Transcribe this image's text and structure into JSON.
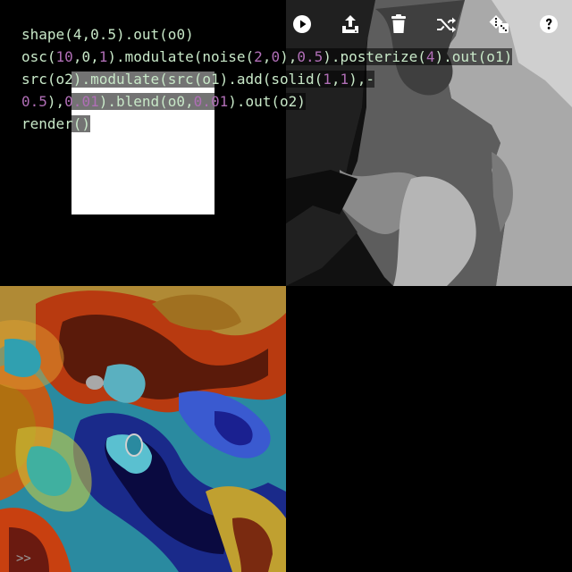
{
  "editor": {
    "lines": [
      [
        {
          "t": "shape",
          "k": "f"
        },
        {
          "t": "(",
          "k": "p"
        },
        {
          "t": "4",
          "k": "f"
        },
        {
          "t": ",",
          "k": "p"
        },
        {
          "t": "0.5",
          "k": "f"
        },
        {
          "t": ").",
          "k": "p"
        },
        {
          "t": "out",
          "k": "f"
        },
        {
          "t": "(o0)",
          "k": "p"
        }
      ],
      [
        {
          "t": "osc",
          "k": "f"
        },
        {
          "t": "(",
          "k": "p"
        },
        {
          "t": "10",
          "k": "n"
        },
        {
          "t": ",",
          "k": "p"
        },
        {
          "t": "0",
          "k": "f"
        },
        {
          "t": ",",
          "k": "p"
        },
        {
          "t": "1",
          "k": "n"
        },
        {
          "t": ").",
          "k": "p"
        },
        {
          "t": "modulate",
          "k": "f"
        },
        {
          "t": "(",
          "k": "p"
        },
        {
          "t": "noise",
          "k": "f"
        },
        {
          "t": "(",
          "k": "p"
        },
        {
          "t": "2",
          "k": "n"
        },
        {
          "t": ",",
          "k": "p"
        },
        {
          "t": "0",
          "k": "n"
        },
        {
          "t": "),",
          "k": "p"
        },
        {
          "t": "0.5",
          "k": "n"
        },
        {
          "t": ").",
          "k": "p"
        },
        {
          "t": "posterize",
          "k": "f"
        },
        {
          "t": "(",
          "k": "p"
        },
        {
          "t": "4",
          "k": "n"
        },
        {
          "t": ").",
          "k": "p"
        },
        {
          "t": "out",
          "k": "f"
        },
        {
          "t": "(o1)",
          "k": "p"
        }
      ],
      [
        {
          "t": "src",
          "k": "f"
        },
        {
          "t": "(o2).",
          "k": "p"
        },
        {
          "t": "modulate",
          "k": "f"
        },
        {
          "t": "(",
          "k": "p"
        },
        {
          "t": "src",
          "k": "f"
        },
        {
          "t": "(o1).",
          "k": "p"
        },
        {
          "t": "add",
          "k": "f"
        },
        {
          "t": "(",
          "k": "p"
        },
        {
          "t": "solid",
          "k": "f"
        },
        {
          "t": "(",
          "k": "p"
        },
        {
          "t": "1",
          "k": "n"
        },
        {
          "t": ",",
          "k": "p"
        },
        {
          "t": "1",
          "k": "n"
        },
        {
          "t": "),-",
          "k": "p"
        }
      ],
      [
        {
          "t": "0.5",
          "k": "n"
        },
        {
          "t": "),",
          "k": "p"
        },
        {
          "t": "0.01",
          "k": "n"
        },
        {
          "t": ").",
          "k": "p"
        },
        {
          "t": "blend",
          "k": "f"
        },
        {
          "t": "(o0,",
          "k": "p"
        },
        {
          "t": "0.01",
          "k": "n"
        },
        {
          "t": ").",
          "k": "p"
        },
        {
          "t": "out",
          "k": "f"
        },
        {
          "t": "(o2)",
          "k": "p"
        }
      ],
      [
        {
          "t": "render",
          "k": "f"
        },
        {
          "t": "()",
          "k": "p"
        }
      ]
    ]
  },
  "toolbar": {
    "buttons": [
      {
        "name": "run-button",
        "icon": "play-icon"
      },
      {
        "name": "upload-button",
        "icon": "upload-icon"
      },
      {
        "name": "clear-button",
        "icon": "trash-icon"
      },
      {
        "name": "shuffle-button",
        "icon": "shuffle-icon"
      },
      {
        "name": "random-button",
        "icon": "dice-icon"
      },
      {
        "name": "help-button",
        "icon": "help-icon"
      }
    ]
  },
  "console": {
    "prompt": ">>"
  },
  "colors": {
    "code_text": "#c8e8c8",
    "code_number": "#b06eb6",
    "icon": "#ffffff",
    "background": "#000000"
  }
}
